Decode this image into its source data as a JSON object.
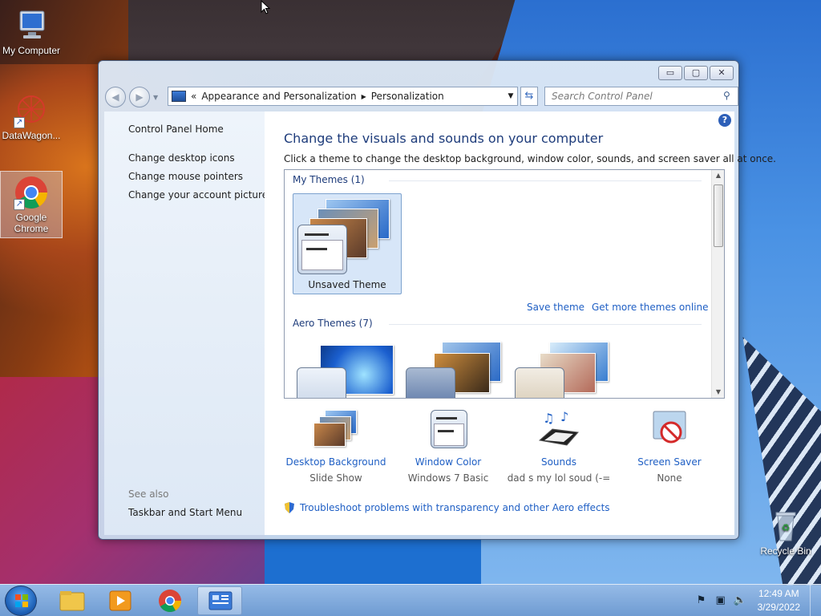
{
  "desktop": {
    "icons": [
      {
        "label": "My Computer"
      },
      {
        "label": "DataWagon..."
      },
      {
        "label": "Google Chrome"
      },
      {
        "label": "Recycle Bin"
      }
    ]
  },
  "window": {
    "address": {
      "chevron": "«",
      "crumb1": "Appearance and Personalization",
      "crumb2": "Personalization"
    },
    "search_placeholder": "Search Control Panel",
    "left": {
      "home": "Control Panel Home",
      "links": [
        "Change desktop icons",
        "Change mouse pointers",
        "Change your account picture"
      ],
      "see_also": "See also",
      "see_also_links": [
        "Taskbar and Start Menu"
      ]
    },
    "main": {
      "title": "Change the visuals and sounds on your computer",
      "subtitle": "Click a theme to change the desktop background, window color, sounds, and screen saver all at once.",
      "groups": [
        {
          "label": "My Themes (1)"
        },
        {
          "label": "Aero Themes (7)"
        }
      ],
      "unsaved_theme": "Unsaved Theme",
      "save_theme": "Save theme",
      "get_more": "Get more themes online",
      "bottom": [
        {
          "label": "Desktop Background",
          "value": "Slide Show"
        },
        {
          "label": "Window Color",
          "value": "Windows 7 Basic"
        },
        {
          "label": "Sounds",
          "value": "dad s my lol soud (-="
        },
        {
          "label": "Screen Saver",
          "value": "None"
        }
      ],
      "troubleshoot": "Troubleshoot problems with transparency and other Aero effects"
    }
  },
  "taskbar": {
    "time": "12:49 AM",
    "date": "3/29/2022"
  }
}
